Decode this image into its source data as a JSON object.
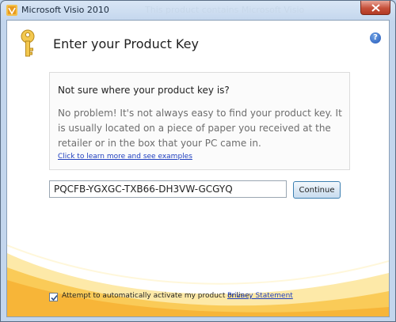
{
  "window": {
    "title": "Microsoft Visio 2010",
    "background_title": "This product contains Microsoft Visio"
  },
  "header": {
    "title": "Enter your Product Key",
    "key_icon": "key-icon",
    "help_icon": "help-icon",
    "help_glyph": "?"
  },
  "info": {
    "heading": "Not sure where your product key is?",
    "body": "No problem! It's not always easy to find your product key. It is usually located on a piece of paper you received at the retailer or in the box that your PC came in.",
    "link": "Click to learn more and see examples"
  },
  "product_key": {
    "value": "PQCFB-YGXGC-TXB66-DH3VW-GCGYQ",
    "continue_label": "Continue"
  },
  "footer": {
    "activate_label": "Attempt to automatically activate my product online.",
    "activate_checked": true,
    "privacy_link": "Privacy Statement"
  },
  "colors": {
    "accent_orange": "#f5a623",
    "link_blue": "#1f3fbf",
    "close_red": "#c6503a"
  }
}
